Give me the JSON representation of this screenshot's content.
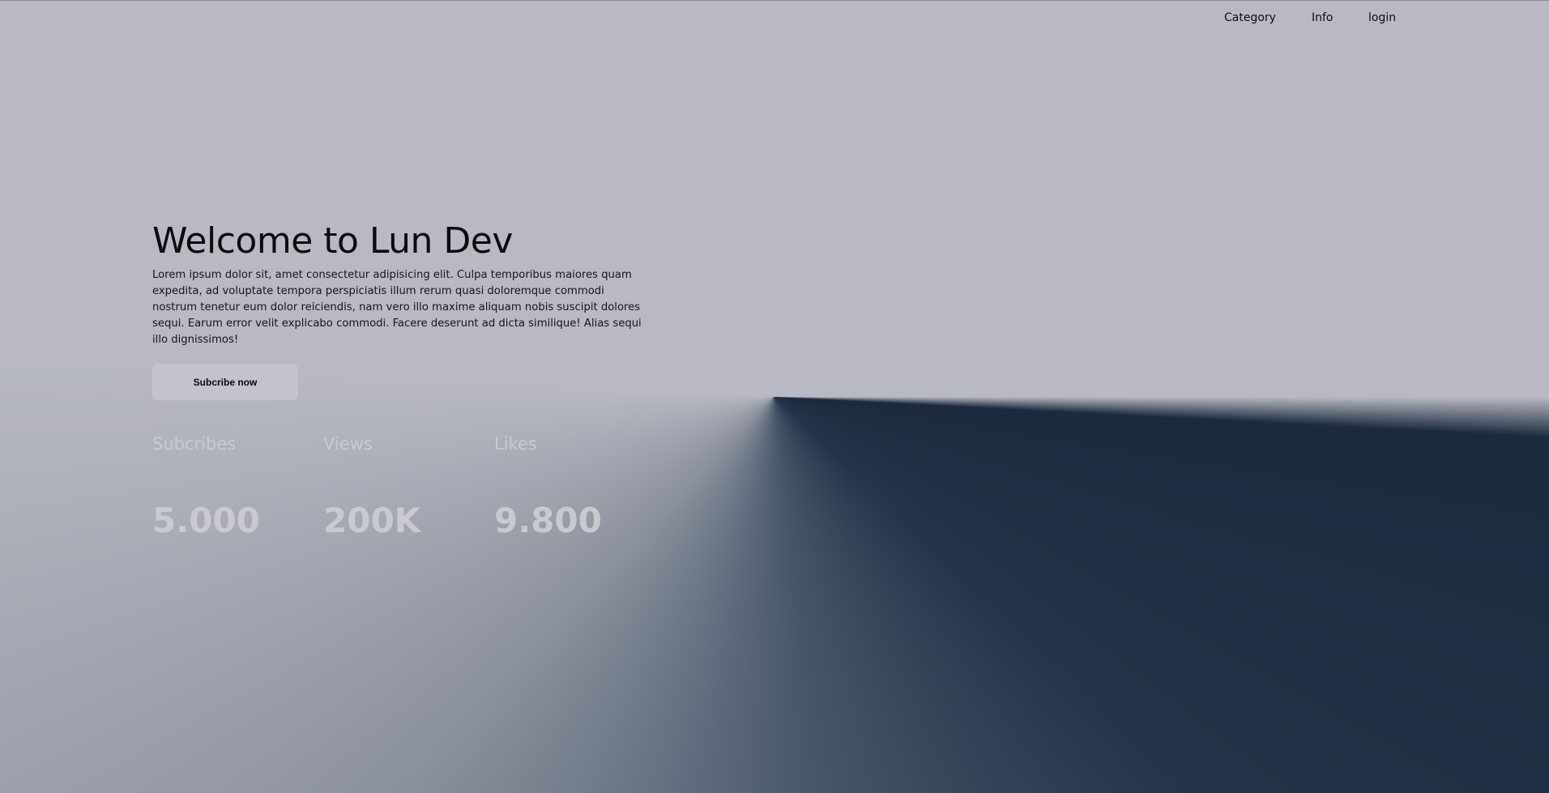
{
  "nav": {
    "items": [
      {
        "label": "Category"
      },
      {
        "label": "Info"
      },
      {
        "label": "login"
      }
    ]
  },
  "hero": {
    "title": "Welcome to Lun Dev",
    "description": "Lorem ipsum dolor sit, amet consectetur adipisicing elit. Culpa temporibus maiores quam expedita, ad voluptate tempora perspiciatis illum rerum quasi doloremque commodi nostrum tenetur eum dolor reiciendis, nam vero illo maxime aliquam nobis suscipit dolores sequi. Earum error velit explicabo commodi. Facere deserunt ad dicta similique! Alias sequi illo dignissimos!",
    "cta_label": "Subcribe now"
  },
  "stats": [
    {
      "label": "Subcribes",
      "value": "5.000"
    },
    {
      "label": "Views",
      "value": "200K"
    },
    {
      "label": "Likes",
      "value": "9.800"
    }
  ],
  "colors": {
    "dark": "#1b2a3f",
    "light": "#b8b9c2",
    "button": "#c2c3cb",
    "stat_text": "#c9cad0"
  }
}
